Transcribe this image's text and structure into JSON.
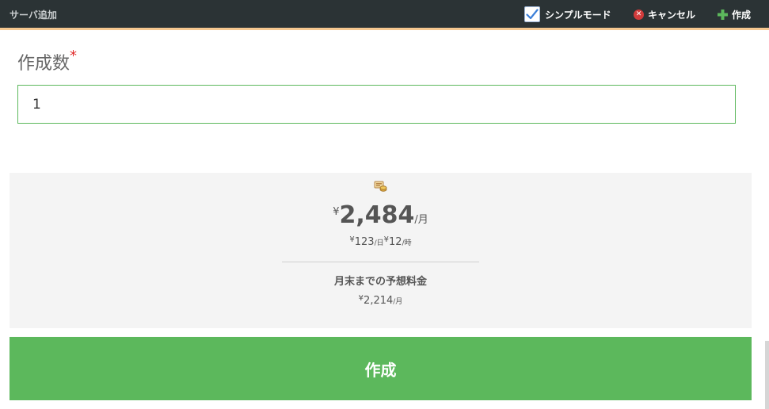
{
  "header": {
    "title": "サーバ追加",
    "simple_mode_label": "シンプルモード",
    "cancel_label": "キャンセル",
    "create_label": "作成"
  },
  "form": {
    "quantity_label": "作成数",
    "required_mark": "*",
    "quantity_value": "1"
  },
  "pricing": {
    "currency": "¥",
    "monthly_amount": "2,484",
    "monthly_unit": "/月",
    "daily_amount": "123",
    "daily_unit": "/日",
    "hourly_amount": "12",
    "hourly_unit": "/時",
    "estimate_label": "月末までの予想料金",
    "estimate_amount": "2,214",
    "estimate_unit": "/月"
  },
  "actions": {
    "submit_label": "作成"
  },
  "colors": {
    "topbar_bg": "#2b3335",
    "accent_border": "#f6c890",
    "primary_green": "#5cb85c",
    "cancel_red": "#d23b3b",
    "checkbox_blue": "#3b7fd8"
  }
}
